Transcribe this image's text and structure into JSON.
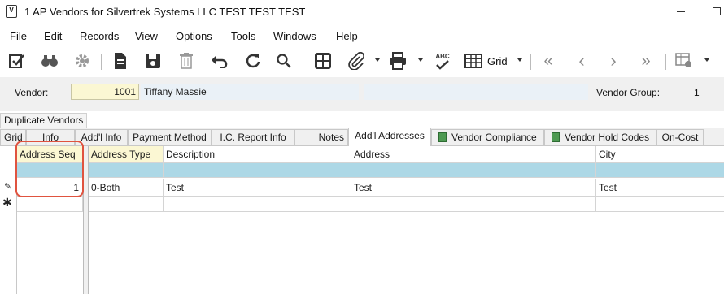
{
  "window": {
    "title": "1 AP Vendors for Silvertrek Systems LLC TEST TEST TEST",
    "app_icon_glyph": "V"
  },
  "menu": [
    "File",
    "Edit",
    "Records",
    "View",
    "Options",
    "Tools",
    "Windows",
    "Help"
  ],
  "toolbar": {
    "icons": [
      "edit-check-icon",
      "binoculars-icon",
      "gear-icon",
      "document-icon",
      "save-icon",
      "trash-icon",
      "undo-icon",
      "refresh-icon",
      "search-icon",
      "calculator-icon",
      "paperclip-icon",
      "printer-icon",
      "spellcheck-icon",
      "grid-icon",
      "first-icon",
      "previous-icon",
      "next-icon",
      "last-icon",
      "grid-settings-icon"
    ],
    "grid_label": "Grid",
    "spellcheck_glyph": "ABC",
    "nav": [
      "«",
      "‹",
      "›",
      "»"
    ]
  },
  "header": {
    "vendor_label": "Vendor:",
    "vendor_number": "1001",
    "vendor_name": "Tiffany Massie",
    "vendor_group_label": "Vendor Group:",
    "vendor_group_value": "1"
  },
  "tabs": {
    "duplicate_tab": "Duplicate Vendors",
    "items": [
      "Grid",
      "Info",
      "Add'l Info",
      "Payment Method",
      "I.C. Report Info",
      "Notes",
      "Add'l Addresses",
      "Vendor Compliance",
      "Vendor Hold Codes",
      "On-Cost"
    ],
    "active": "Add'l Addresses"
  },
  "grid": {
    "columns": [
      "Address Seq",
      "Address Type",
      "Description",
      "Address",
      "City"
    ],
    "rows": [
      {
        "address_seq": "1",
        "address_type": "0-Both",
        "description": "Test",
        "address": "Test",
        "city": "Test"
      }
    ],
    "row_marker_editing": "✎",
    "row_marker_new": "✱"
  },
  "colors": {
    "filter_row": "#add8e6",
    "key_field": "#fbf7d3",
    "highlight": "#e0533f"
  }
}
